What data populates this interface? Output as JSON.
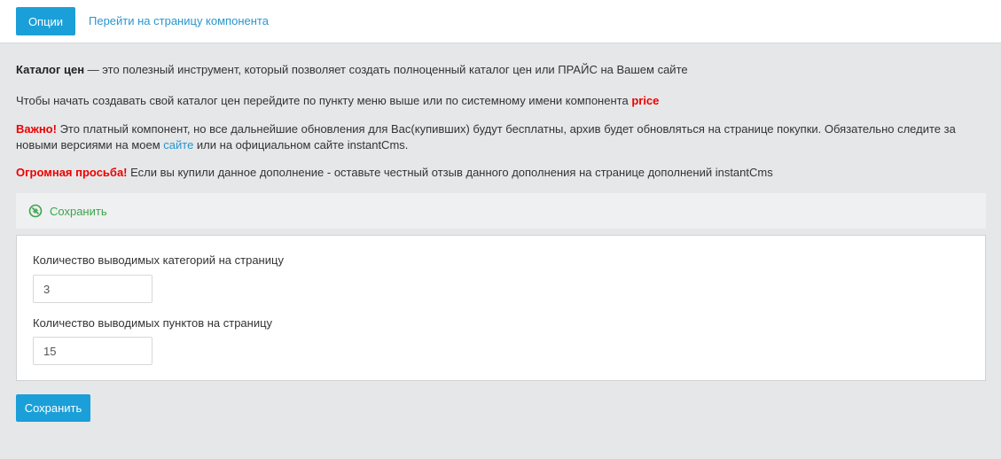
{
  "topbar": {
    "tab_active": "Опции",
    "tab_link": "Перейти на страницу компонента"
  },
  "info": {
    "p1_bold": "Каталог цен",
    "p1_text": " — это полезный инструмент, который позволяет создать полноценный каталог цен или ПРАЙС на Вашем сайте",
    "p2_text": "Чтобы начать создавать свой каталог цен перейдите по пункту меню выше или по системному имени компонента ",
    "p2_red": "price",
    "p3_red": "Важно!",
    "p3_text_a": " Это платный компонент, но все дальнейшие обновления для Вас(купивших) будут бесплатны, архив будет обновляться на странице покупки. Обязательно следите за новыми версиями на моем ",
    "p3_link": "сайте",
    "p3_text_b": " или на официальном сайте instantCms.",
    "p4_red": "Огромная просьба!",
    "p4_text": " Если вы купили данное дополнение - оставьте честный отзыв данного дополнения на странице дополнений instantCms"
  },
  "savebar": {
    "label": "Сохранить",
    "icon": "save-icon"
  },
  "form": {
    "field1_label": "Количество выводимых категорий на страницу",
    "field1_value": "3",
    "field2_label": "Количество выводимых пунктов на страницу",
    "field2_value": "15"
  },
  "save_button": "Сохранить",
  "colors": {
    "accent": "#1b9fd8",
    "link": "#2996cf",
    "warning": "#ee0000",
    "save_green": "#3aa54a"
  }
}
